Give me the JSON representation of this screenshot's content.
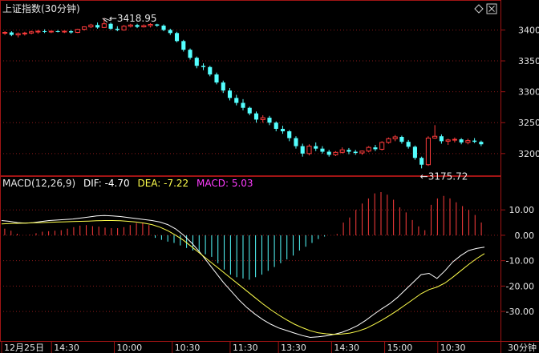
{
  "header": {
    "title": "上证指数(30分钟)",
    "diamond_icon": "diamond-icon",
    "close_icon": "close-icon"
  },
  "macd_header": {
    "name": "MACD(12,26,9)",
    "dif_label": "DIF: -4.70",
    "dea_label": "DEA: -7.22",
    "macd_label": "MACD: 5.03"
  },
  "colors": {
    "up": "#ff3c3c",
    "down": "#54ffff",
    "dif": "#ffffff",
    "dea": "#ffff4c",
    "macd_text": "#ff3cff",
    "grid": "#8b1a1a",
    "frame": "#a01414"
  },
  "time_axis": {
    "labels": [
      "12月25日",
      "14:30",
      "10:00",
      "10:30",
      "11:30",
      "13:30",
      "14:30",
      "15:00",
      "10:30"
    ],
    "unit_label": "30分钟"
  },
  "chart_data": [
    {
      "type": "candlestick",
      "title": "上证指数(30分钟)",
      "ylim": [
        3170,
        3420
      ],
      "yticks": [
        3400,
        3350,
        3300,
        3250,
        3200
      ],
      "annotations": [
        {
          "text": "3418.95",
          "at_index": 15,
          "price": 3418.95
        },
        {
          "text": "3175.72",
          "at_index": 63,
          "price": 3175.72
        }
      ],
      "candles": [
        [
          3395,
          3398,
          3392,
          3396
        ],
        [
          3396,
          3398,
          3390,
          3392
        ],
        [
          3392,
          3396,
          3388,
          3394
        ],
        [
          3394,
          3397,
          3391,
          3395
        ],
        [
          3395,
          3399,
          3393,
          3397
        ],
        [
          3397,
          3400,
          3394,
          3398
        ],
        [
          3398,
          3401,
          3395,
          3397
        ],
        [
          3397,
          3399,
          3395,
          3398
        ],
        [
          3398,
          3400,
          3396,
          3397
        ],
        [
          3397,
          3399,
          3395,
          3398
        ],
        [
          3398,
          3400,
          3394,
          3396
        ],
        [
          3396,
          3402,
          3395,
          3401
        ],
        [
          3401,
          3406,
          3399,
          3405
        ],
        [
          3405,
          3410,
          3403,
          3408
        ],
        [
          3408,
          3412,
          3402,
          3404
        ],
        [
          3404,
          3419,
          3403,
          3410
        ],
        [
          3410,
          3412,
          3400,
          3402
        ],
        [
          3402,
          3406,
          3398,
          3400
        ],
        [
          3400,
          3408,
          3399,
          3406
        ],
        [
          3406,
          3410,
          3404,
          3408
        ],
        [
          3408,
          3410,
          3403,
          3405
        ],
        [
          3405,
          3409,
          3404,
          3407
        ],
        [
          3407,
          3411,
          3404,
          3409
        ],
        [
          3409,
          3410,
          3405,
          3407
        ],
        [
          3407,
          3409,
          3398,
          3400
        ],
        [
          3400,
          3402,
          3392,
          3395
        ],
        [
          3395,
          3397,
          3380,
          3382
        ],
        [
          3382,
          3384,
          3365,
          3368
        ],
        [
          3368,
          3370,
          3352,
          3355
        ],
        [
          3355,
          3357,
          3338,
          3342
        ],
        [
          3342,
          3346,
          3335,
          3340
        ],
        [
          3340,
          3342,
          3325,
          3328
        ],
        [
          3328,
          3331,
          3312,
          3315
        ],
        [
          3315,
          3318,
          3298,
          3302
        ],
        [
          3302,
          3306,
          3286,
          3290
        ],
        [
          3290,
          3295,
          3278,
          3282
        ],
        [
          3282,
          3288,
          3270,
          3274
        ],
        [
          3274,
          3276,
          3262,
          3265
        ],
        [
          3265,
          3268,
          3250,
          3255
        ],
        [
          3255,
          3262,
          3250,
          3258
        ],
        [
          3258,
          3261,
          3246,
          3250
        ],
        [
          3250,
          3252,
          3236,
          3240
        ],
        [
          3240,
          3245,
          3232,
          3236
        ],
        [
          3236,
          3238,
          3220,
          3225
        ],
        [
          3225,
          3228,
          3208,
          3212
        ],
        [
          3212,
          3216,
          3195,
          3200
        ],
        [
          3200,
          3215,
          3197,
          3212
        ],
        [
          3212,
          3218,
          3204,
          3208
        ],
        [
          3208,
          3212,
          3200,
          3203
        ],
        [
          3203,
          3206,
          3195,
          3198
        ],
        [
          3198,
          3204,
          3196,
          3202
        ],
        [
          3202,
          3210,
          3200,
          3206
        ],
        [
          3206,
          3209,
          3199,
          3203
        ],
        [
          3203,
          3206,
          3198,
          3201
        ],
        [
          3201,
          3205,
          3198,
          3204
        ],
        [
          3204,
          3212,
          3202,
          3210
        ],
        [
          3210,
          3214,
          3204,
          3207
        ],
        [
          3207,
          3220,
          3205,
          3218
        ],
        [
          3218,
          3226,
          3216,
          3224
        ],
        [
          3224,
          3230,
          3220,
          3227
        ],
        [
          3227,
          3229,
          3216,
          3219
        ],
        [
          3219,
          3222,
          3208,
          3211
        ],
        [
          3211,
          3213,
          3190,
          3193
        ],
        [
          3193,
          3195,
          3176,
          3182
        ],
        [
          3182,
          3228,
          3180,
          3225
        ],
        [
          3225,
          3246,
          3224,
          3228
        ],
        [
          3228,
          3231,
          3216,
          3220
        ],
        [
          3220,
          3224,
          3214,
          3222
        ],
        [
          3222,
          3226,
          3218,
          3223
        ],
        [
          3223,
          3225,
          3215,
          3218
        ],
        [
          3218,
          3224,
          3215,
          3221
        ],
        [
          3221,
          3225,
          3217,
          3219
        ],
        [
          3219,
          3221,
          3212,
          3215
        ]
      ]
    },
    {
      "type": "bar+line",
      "title": "MACD(12,26,9)",
      "ylim": [
        -41,
        17
      ],
      "yticks": [
        10,
        0,
        -10,
        -20,
        -30
      ],
      "ytick_labels": [
        "10.00",
        "0.00",
        "-10.00",
        "-20.00",
        "-30.00"
      ],
      "series": [
        {
          "name": "DIF",
          "values": [
            5.8,
            5.5,
            5.0,
            4.8,
            5.0,
            5.4,
            5.8,
            6.0,
            6.2,
            6.4,
            6.8,
            7.2,
            7.6,
            7.8,
            7.6,
            7.4,
            7.0,
            6.6,
            6.2,
            5.8,
            5.2,
            4.2,
            2.5,
            0.0,
            -3.0,
            -6.5,
            -10.5,
            -14.5,
            -18.5,
            -22.0,
            -25.5,
            -28.5,
            -31.0,
            -33.2,
            -35.0,
            -36.5,
            -37.5,
            -38.5,
            -39.5,
            -40.2,
            -40.0,
            -39.6,
            -39.0,
            -38.2,
            -37.0,
            -35.5,
            -33.5,
            -31.2,
            -29.0,
            -27.0,
            -24.5,
            -21.5,
            -18.5,
            -15.5,
            -15.0,
            -17.0,
            -14.0,
            -10.5,
            -8.0,
            -6.0,
            -5.2,
            -4.7
          ]
        },
        {
          "name": "DEA",
          "values": [
            4.5,
            4.6,
            4.7,
            4.8,
            4.9,
            5.0,
            5.1,
            5.2,
            5.3,
            5.4,
            5.5,
            5.6,
            5.7,
            5.8,
            5.8,
            5.7,
            5.5,
            5.2,
            4.8,
            4.2,
            3.2,
            1.8,
            0.0,
            -2.0,
            -4.5,
            -7.0,
            -9.5,
            -12.0,
            -14.5,
            -17.0,
            -19.5,
            -22.0,
            -24.5,
            -27.0,
            -29.3,
            -31.4,
            -33.3,
            -35.0,
            -36.4,
            -37.6,
            -38.4,
            -38.8,
            -39.0,
            -38.9,
            -38.5,
            -37.8,
            -36.7,
            -35.2,
            -33.5,
            -31.6,
            -29.6,
            -27.4,
            -25.2,
            -23.0,
            -21.4,
            -20.4,
            -18.8,
            -16.5,
            -14.0,
            -11.5,
            -9.2,
            -7.22
          ]
        },
        {
          "name": "MACD",
          "values": [
            2.6,
            1.8,
            0.6,
            0.0,
            0.2,
            0.8,
            1.4,
            1.6,
            1.8,
            2.0,
            2.6,
            3.2,
            3.8,
            4.0,
            3.6,
            3.4,
            3.0,
            2.8,
            2.8,
            3.2,
            4.0,
            4.8,
            5.0,
            4.0,
            -1.0,
            -1.8,
            -2.5,
            -3.0,
            -4.0,
            -5.0,
            -6.0,
            -6.5,
            -7.5,
            -8.5,
            -11.0,
            -13.5,
            -15.5,
            -16.5,
            -17.0,
            -17.5,
            -16.5,
            -15.5,
            -14.0,
            -12.5,
            -11.0,
            -9.5,
            -8.0,
            -6.0,
            -4.5,
            -3.0,
            -1.5,
            -0.5,
            0.0,
            0.5,
            5.0,
            7.0,
            10.0,
            12.5,
            14.5,
            16.5,
            17.0,
            16.0,
            14.0,
            11.0,
            9.0,
            6.0,
            3.5,
            2.0,
            12.0,
            14.5,
            15.5,
            14.5,
            13.0,
            11.5,
            10.0,
            8.0,
            5.03
          ]
        }
      ]
    }
  ]
}
